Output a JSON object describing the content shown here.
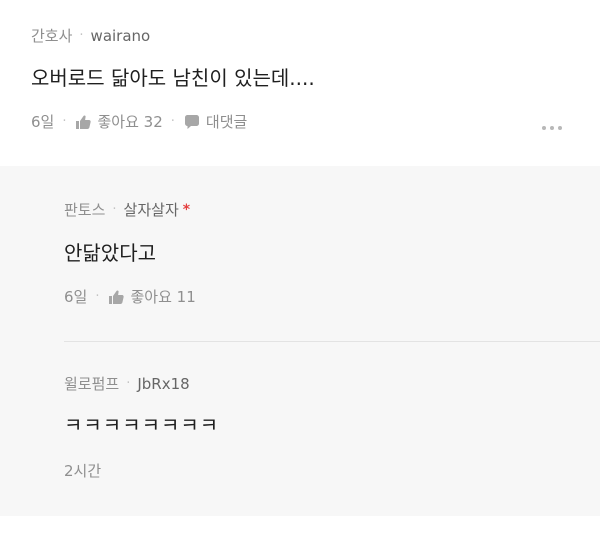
{
  "main_comment": {
    "nickname": "간호사",
    "username": "wairano",
    "text": "오버로드 닮아도 남친이 있는데....",
    "date": "6일",
    "like_label": "좋아요 32",
    "reply_label": "대댓글",
    "like_icon": "thumbs-up-icon",
    "reply_icon": "speech-bubble-icon",
    "more_icon": "more-dots-icon"
  },
  "reply_1": {
    "nickname": "판토스",
    "username": "살자살자",
    "required_mark": "*",
    "text": "안닮았다고",
    "date": "6일",
    "like_label": "좋아요 11",
    "like_icon": "thumbs-up-icon"
  },
  "reply_2": {
    "nickname": "윌로펌프",
    "username": "JbRx18",
    "text": "ㅋㅋㅋㅋㅋㅋㅋㅋ",
    "date": "2시간"
  },
  "colors": {
    "background": "#ffffff",
    "reply_background": "#f7f7f7",
    "text": "#1f1f1f",
    "meta_text": "#8f8f8f",
    "accent_red": "#e43f3f"
  }
}
